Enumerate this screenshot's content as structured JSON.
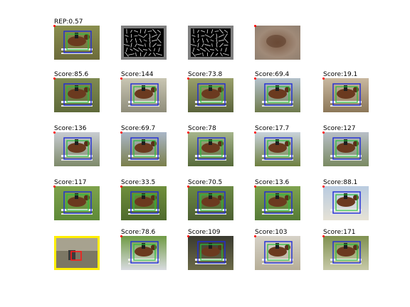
{
  "figure": {
    "rows": [
      {
        "cells": [
          {
            "label": "REP:0.57",
            "kind": "photo",
            "bg": [
              "#8a8f4e",
              "#6c6b3b"
            ]
          },
          {
            "label": "",
            "kind": "hog"
          },
          {
            "label": "",
            "kind": "hog"
          },
          {
            "label": "",
            "kind": "blur"
          }
        ]
      },
      {
        "cells": [
          {
            "label": "Score:85.6",
            "kind": "photo",
            "bg": [
              "#7f8a52",
              "#5f6a3a"
            ]
          },
          {
            "label": "Score:144",
            "kind": "photo",
            "bg": [
              "#c9c6b3",
              "#8f8d7a"
            ]
          },
          {
            "label": "Score:73.8",
            "kind": "photo",
            "bg": [
              "#9aa06c",
              "#5a633b"
            ]
          },
          {
            "label": "Score:69.4",
            "kind": "photo",
            "bg": [
              "#b5c2cc",
              "#6e7a4c"
            ]
          },
          {
            "label": "Score:19.1",
            "kind": "photo",
            "bg": [
              "#c9b8a0",
              "#8c7758"
            ]
          }
        ]
      },
      {
        "cells": [
          {
            "label": "Score:136",
            "kind": "photo",
            "bg": [
              "#c8ccd2",
              "#7e8a6a"
            ]
          },
          {
            "label": "Score:69.7",
            "kind": "photo",
            "bg": [
              "#a9b6c7",
              "#7b7f4b"
            ]
          },
          {
            "label": "Score:78",
            "kind": "photo",
            "bg": [
              "#a6b58c",
              "#576b3a"
            ]
          },
          {
            "label": "Score:17.7",
            "kind": "photo",
            "bg": [
              "#c9d3dc",
              "#6d7f3f"
            ]
          },
          {
            "label": "Score:127",
            "kind": "photo",
            "bg": [
              "#b8bfc7",
              "#7a8a62"
            ]
          }
        ]
      },
      {
        "cells": [
          {
            "label": "Score:117",
            "kind": "photo",
            "bg": [
              "#7ea24c",
              "#5e8a38"
            ]
          },
          {
            "label": "Score:33.5",
            "kind": "photo",
            "bg": [
              "#6f8f3c",
              "#4f6a2c"
            ]
          },
          {
            "label": "Score:70.5",
            "kind": "photo",
            "bg": [
              "#6c8a44",
              "#4c5f32"
            ]
          },
          {
            "label": "Score:13.6",
            "kind": "photo",
            "bg": [
              "#7fa34f",
              "#557a36"
            ]
          },
          {
            "label": "Score:88.1",
            "kind": "photo",
            "bg": [
              "#b9cbe0",
              "#e6e2d6"
            ]
          }
        ]
      },
      {
        "cells": [
          {
            "label": "",
            "kind": "query",
            "bg": [
              "#a7a28f",
              "#7c7764"
            ]
          },
          {
            "label": "Score:78.6",
            "kind": "photo",
            "bg": [
              "#6f9a44",
              "#d9dbe0"
            ]
          },
          {
            "label": "Score:109",
            "kind": "photo",
            "bg": [
              "#3a3a30",
              "#6c6a48"
            ]
          },
          {
            "label": "Score:103",
            "kind": "photo",
            "bg": [
              "#d6d2c8",
              "#b6ae98"
            ]
          },
          {
            "label": "Score:171",
            "kind": "photo",
            "bg": [
              "#7f9150",
              "#c7c9a8"
            ]
          }
        ]
      }
    ],
    "colors": {
      "box_blue": "#1f2bd8",
      "box_green": "#28c03a",
      "box_red": "#ff1a1a",
      "highlight": "#ffee00"
    }
  }
}
